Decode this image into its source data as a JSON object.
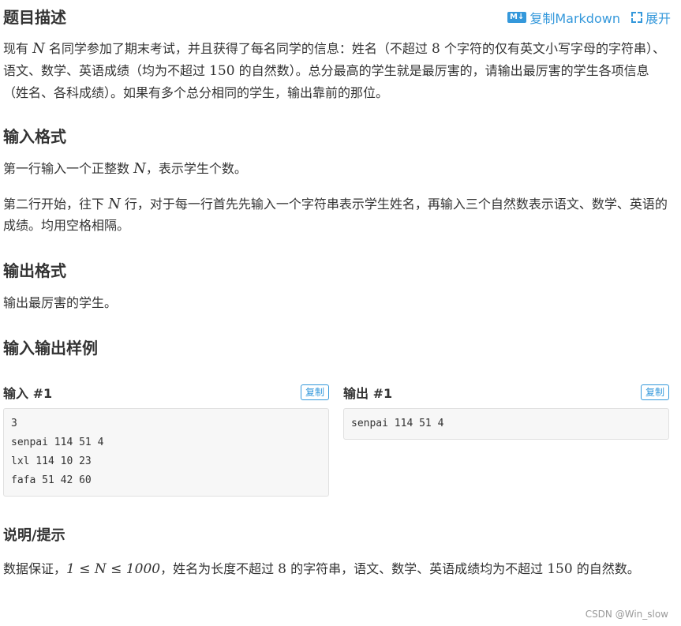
{
  "header": {
    "title": "题目描述",
    "copy_md_icon": "M↓",
    "copy_md_label": "复制Markdown",
    "expand_label": "展开"
  },
  "description": {
    "p1_a": "现有 ",
    "p1_var": "N",
    "p1_b": " 名同学参加了期末考试，并且获得了每名同学的信息：姓名（不超过 ",
    "p1_num1": "8",
    "p1_c": " 个字符的仅有英文小写字母的字符串）、语文、数学、英语成绩（均为不超过 ",
    "p1_num2": "150",
    "p1_d": " 的自然数）。总分最高的学生就是最厉害的，请输出最厉害的学生各项信息（姓名、各科成绩）。如果有多个总分相同的学生，输出靠前的那位。"
  },
  "input_format": {
    "title": "输入格式",
    "l1_a": "第一行输入一个正整数 ",
    "l1_var": "N",
    "l1_b": "，表示学生个数。",
    "l2_a": "第二行开始，往下 ",
    "l2_var": "N",
    "l2_b": " 行，对于每一行首先先输入一个字符串表示学生姓名，再输入三个自然数表示语文、数学、英语的成绩。均用空格相隔。"
  },
  "output_format": {
    "title": "输出格式",
    "text": "输出最厉害的学生。"
  },
  "samples": {
    "title": "输入输出样例",
    "input_title": "输入 #1",
    "output_title": "输出 #1",
    "copy_label": "复制",
    "input_text": "3\nsenpai 114 51 4\nlxl 114 10 23\nfafa 51 42 60",
    "output_text": "senpai 114 51 4"
  },
  "hint": {
    "title": "说明/提示",
    "a": "数据保证，",
    "math": "1 ≤ N ≤ 1000",
    "b": "，姓名为长度不超过 ",
    "num1": "8",
    "c": " 的字符串，语文、数学、英语成绩均为不超过 ",
    "num2": "150",
    "d": " 的自然数。"
  },
  "watermark": "CSDN @Win_slow"
}
